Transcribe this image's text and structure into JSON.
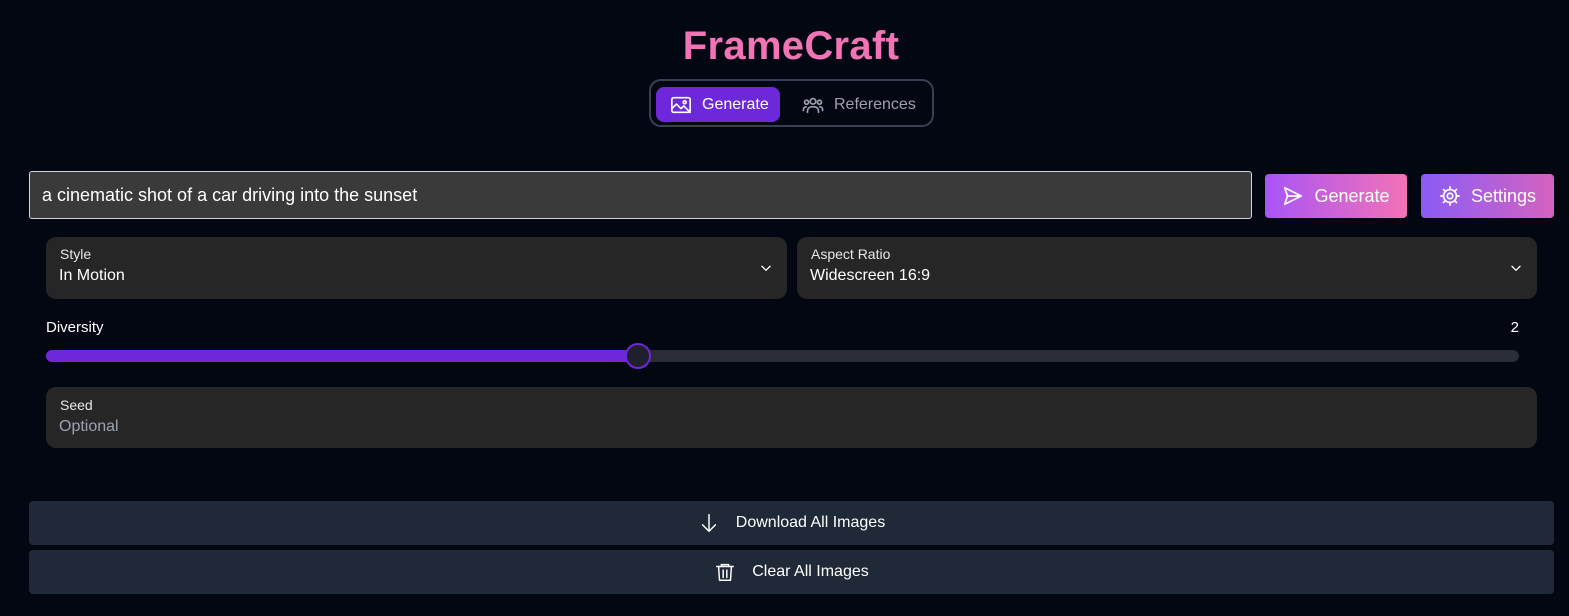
{
  "app": {
    "title": "FrameCraft"
  },
  "tabs": [
    {
      "label": "Generate",
      "icon": "image-icon",
      "active": true
    },
    {
      "label": "References",
      "icon": "users-icon",
      "active": false
    }
  ],
  "prompt": {
    "value": "a cinematic shot of a car driving into the sunset"
  },
  "actions": {
    "generate_label": "Generate",
    "settings_label": "Settings"
  },
  "options": {
    "style": {
      "label": "Style",
      "value": "In Motion"
    },
    "aspect_ratio": {
      "label": "Aspect Ratio",
      "value": "Widescreen 16:9"
    }
  },
  "diversity": {
    "label": "Diversity",
    "value": "2",
    "fill_fraction": 0.402
  },
  "seed": {
    "label": "Seed",
    "placeholder": "Optional",
    "value": ""
  },
  "bulk": {
    "download_label": "Download All Images",
    "clear_label": "Clear All Images"
  },
  "colors": {
    "background": "#030712",
    "title": "#f472b6",
    "accent": "#6d28d9",
    "panel": "#262626",
    "bulk_button": "#1f2937"
  }
}
